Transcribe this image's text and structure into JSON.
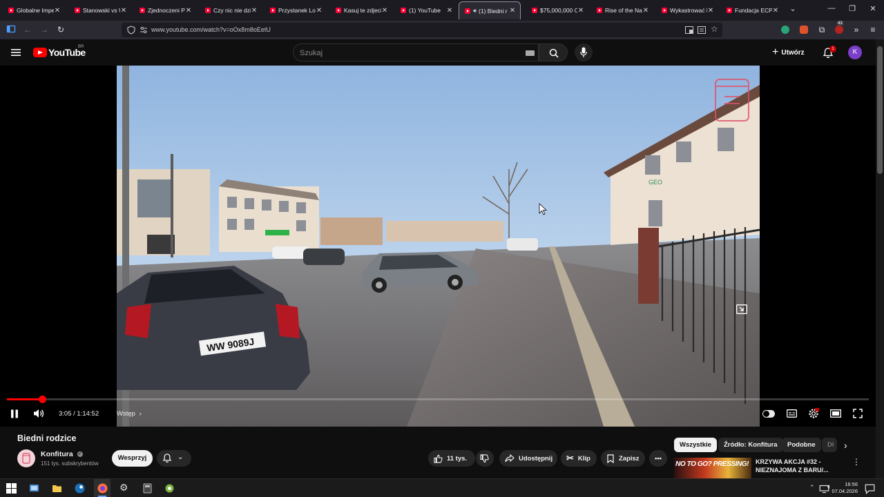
{
  "browser": {
    "tabs": [
      {
        "label": "Globalne Imper",
        "active": false
      },
      {
        "label": "Stanowski vs W",
        "active": false
      },
      {
        "label": "Zjednoczeni Prz",
        "active": false
      },
      {
        "label": "Czy nic nie dziej",
        "active": false
      },
      {
        "label": "Przystanek Lom",
        "active": false
      },
      {
        "label": "Kasuj te zdjecia",
        "active": false
      },
      {
        "label": "(1) YouTube",
        "active": false
      },
      {
        "label": "(1) Biedni r",
        "active": true
      },
      {
        "label": "$75,000,000 Cry",
        "active": false
      },
      {
        "label": "Rise of the Nazi",
        "active": false
      },
      {
        "label": "Wykastrować b",
        "active": false
      },
      {
        "label": "Fundacja ECPU",
        "active": false
      }
    ],
    "url": "www.youtube.com/watch?v=oOx8m8oEetU",
    "extension_badge": "43"
  },
  "youtube": {
    "logo_text": "YouTube",
    "country_code": "BR",
    "search_placeholder": "Szukaj",
    "create_label": "Utwórz",
    "notification_count": "1",
    "avatar_letter": "K",
    "accent_color": "#ff0000"
  },
  "player": {
    "current_time": "3:05",
    "duration": "1:14:52",
    "time_display": "3:05 / 1:14:52",
    "chapter": "Wstęp",
    "progress_fraction": 0.0412,
    "plate_text": "WW 9089J",
    "building_sign": "GEO"
  },
  "video": {
    "title": "Biedni rodzice",
    "channel_name": "Konfitura",
    "subscribers": "151 tys. subskrybentów",
    "join_label": "Wesprzyj",
    "likes": "11 tys.",
    "share_label": "Udostępnij",
    "clip_label": "Klip",
    "save_label": "Zapisz"
  },
  "sidebar": {
    "chips": [
      "Wszystkie",
      "Źródło: Konfitura",
      "Podobne",
      "Dl"
    ],
    "rec_title": "KRZYWA AKCJA #32 - NIEZNAJOMA Z BARU/...",
    "rec_thumb_text": "NO TO GO? PRESSING!"
  },
  "taskbar": {
    "time": "16:56",
    "date": "07.04.2026"
  }
}
